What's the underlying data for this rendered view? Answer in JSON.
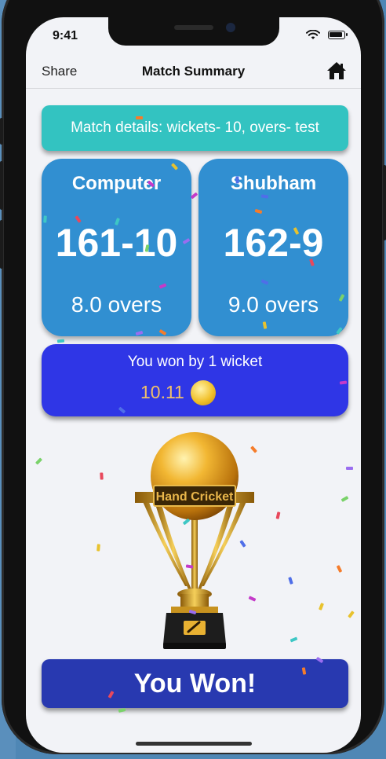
{
  "status_bar": {
    "time": "9:41"
  },
  "nav": {
    "share_label": "Share",
    "title": "Match Summary"
  },
  "match_details": "Match details: wickets- 10, overs- test",
  "teams": [
    {
      "name": "Computer",
      "score": "161-10",
      "overs": "8.0 overs"
    },
    {
      "name": "Shubham",
      "score": "162-9",
      "overs": "9.0 overs"
    }
  ],
  "result": {
    "text": "You won by 1 wicket",
    "coins": "10.11"
  },
  "trophy": {
    "label": "Hand Cricket"
  },
  "banner": "You Won!",
  "colors": {
    "details_bg": "#33c3c1",
    "score_card_bg": "#318fd1",
    "result_bg": "#2f36e6",
    "banner_bg": "#2839b0",
    "coins_text": "#f0c06a"
  }
}
